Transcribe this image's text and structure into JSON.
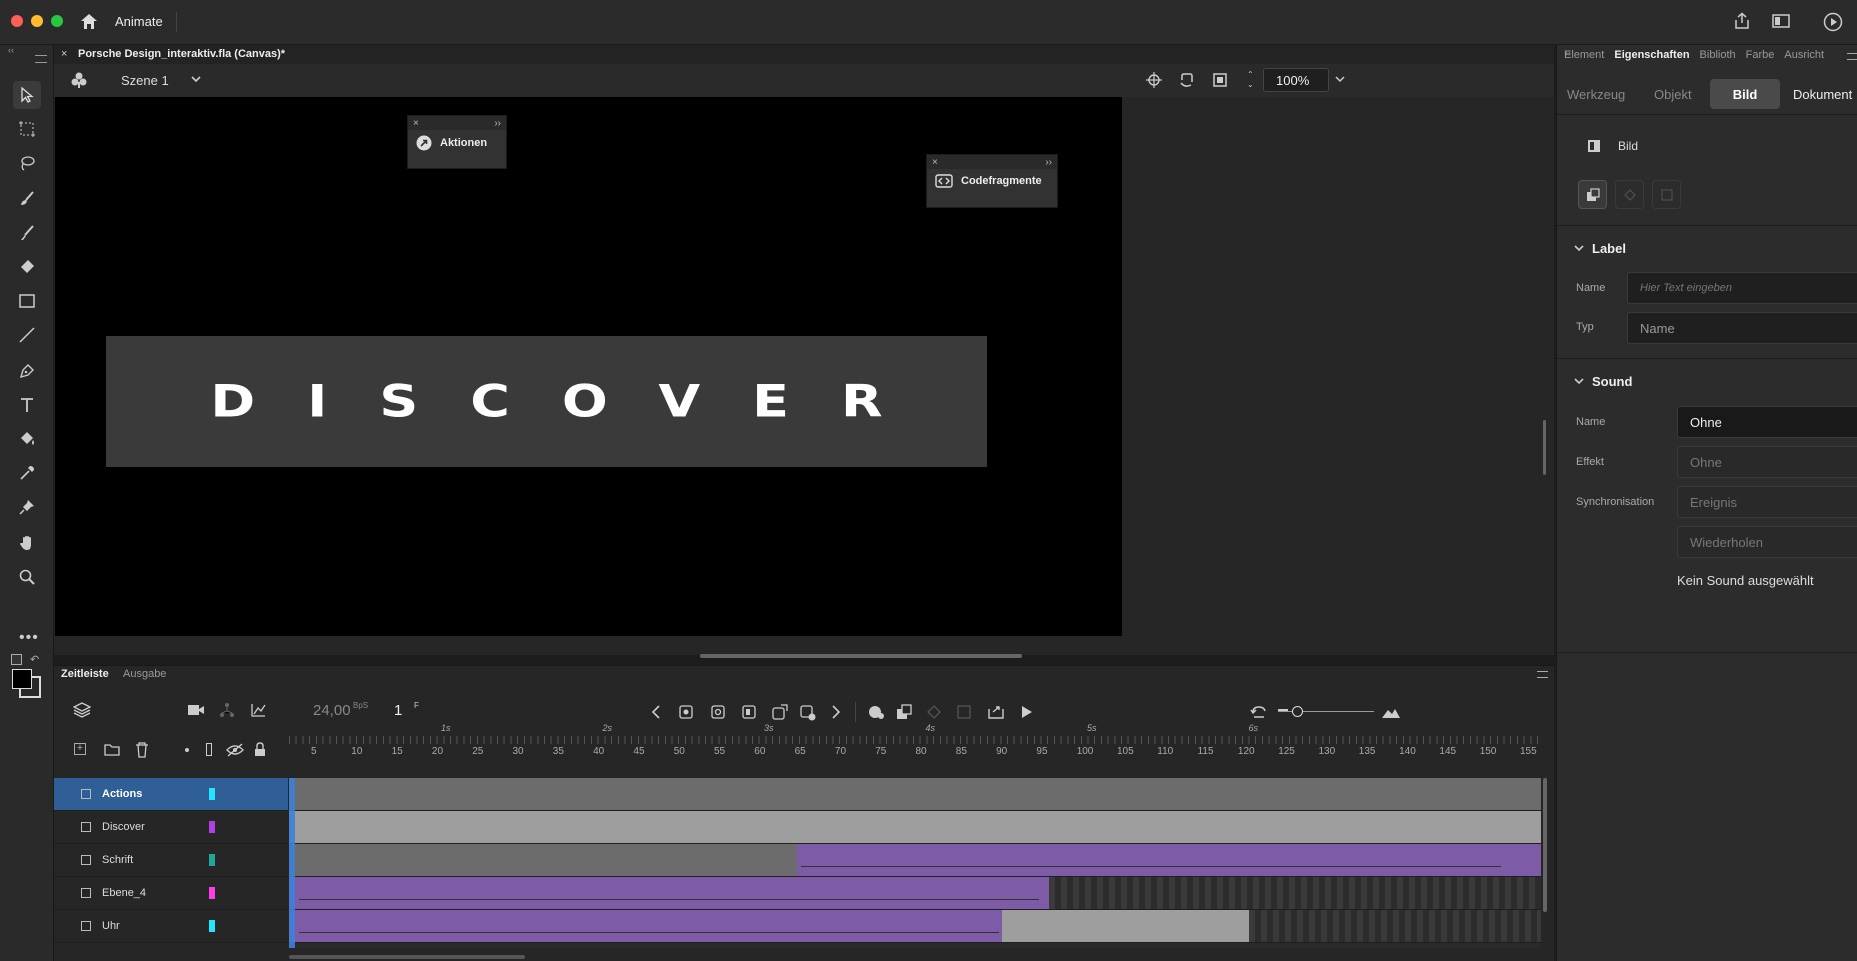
{
  "app": {
    "name": "Animate"
  },
  "document": {
    "tab_title": "Porsche Design_interaktiv.fla (Canvas)*",
    "scene": "Szene 1",
    "zoom": "100%"
  },
  "stage": {
    "text": "DISCOVER"
  },
  "floating_panels": {
    "actions": "Aktionen",
    "code_snippets": "Codefragmente"
  },
  "properties": {
    "tabs": [
      "Element",
      "Eigenschaften",
      "Biblioth",
      "Farbe",
      "Ausricht"
    ],
    "subtabs": [
      "Werkzeug",
      "Objekt",
      "Bild",
      "Dokument"
    ],
    "section_title": "Bild",
    "label_section": {
      "title": "Label",
      "name_label": "Name",
      "name_placeholder": "Hier Text eingeben",
      "type_label": "Typ",
      "type_value": "Name"
    },
    "sound_section": {
      "title": "Sound",
      "name_label": "Name",
      "name_value": "Ohne",
      "effect_label": "Effekt",
      "effect_value": "Ohne",
      "sync_label": "Synchronisation",
      "sync_value": "Ereignis",
      "repeat_value": "Wiederholen",
      "status": "Kein Sound ausgewählt"
    }
  },
  "timeline": {
    "tabs": [
      "Zeitleiste",
      "Ausgabe"
    ],
    "fps": "24,00",
    "fps_unit": "BpS",
    "frame": "1",
    "frame_unit": "F",
    "seconds": [
      "1s",
      "2s",
      "3s",
      "4s",
      "5s",
      "6s"
    ],
    "frame_numbers": [
      "5",
      "10",
      "15",
      "20",
      "25",
      "30",
      "35",
      "40",
      "45",
      "50",
      "55",
      "60",
      "65",
      "70",
      "75",
      "80",
      "85",
      "90",
      "95",
      "100",
      "105",
      "110",
      "115",
      "120",
      "125",
      "130",
      "135",
      "140",
      "145",
      "150",
      "155"
    ],
    "layers": [
      {
        "name": "Actions",
        "color": "#22e5ff",
        "selected": true
      },
      {
        "name": "Discover",
        "color": "#b33ee6",
        "selected": false
      },
      {
        "name": "Schrift",
        "color": "#1ea89a",
        "selected": false
      },
      {
        "name": "Ebene_4",
        "color": "#ff3ee9",
        "selected": false
      },
      {
        "name": "Uhr",
        "color": "#22e5ff",
        "selected": false
      }
    ]
  },
  "colors": {
    "accent": "#3d7fd6",
    "tween": "#7d5ba6",
    "selected_layer": "#2f5f96"
  }
}
